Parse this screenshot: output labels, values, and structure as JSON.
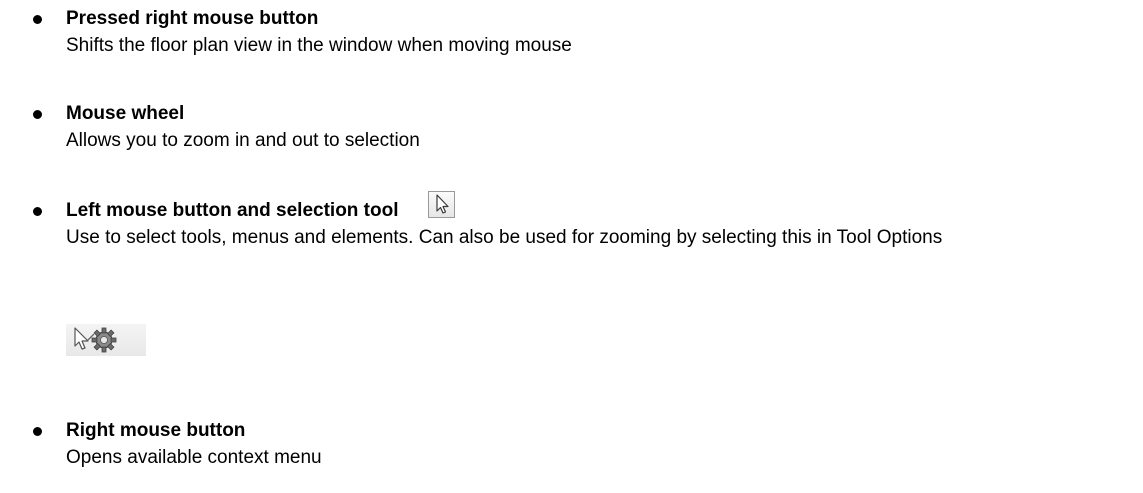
{
  "items": [
    {
      "title": "Pressed right mouse button",
      "description": "Shifts the floor plan view in the window when moving mouse"
    },
    {
      "title": "Mouse wheel",
      "description": "Allows you to zoom in and out to selection"
    },
    {
      "title": "Left mouse button and selection tool",
      "description": "Use to select tools, menus and elements.  Can also be used for zooming by selecting this in Tool Options",
      "icon": "arrow-pointer-icon",
      "extra_icon": "pointer-gear-icon"
    },
    {
      "title": "Right mouse button",
      "description": "Opens available context menu"
    }
  ]
}
